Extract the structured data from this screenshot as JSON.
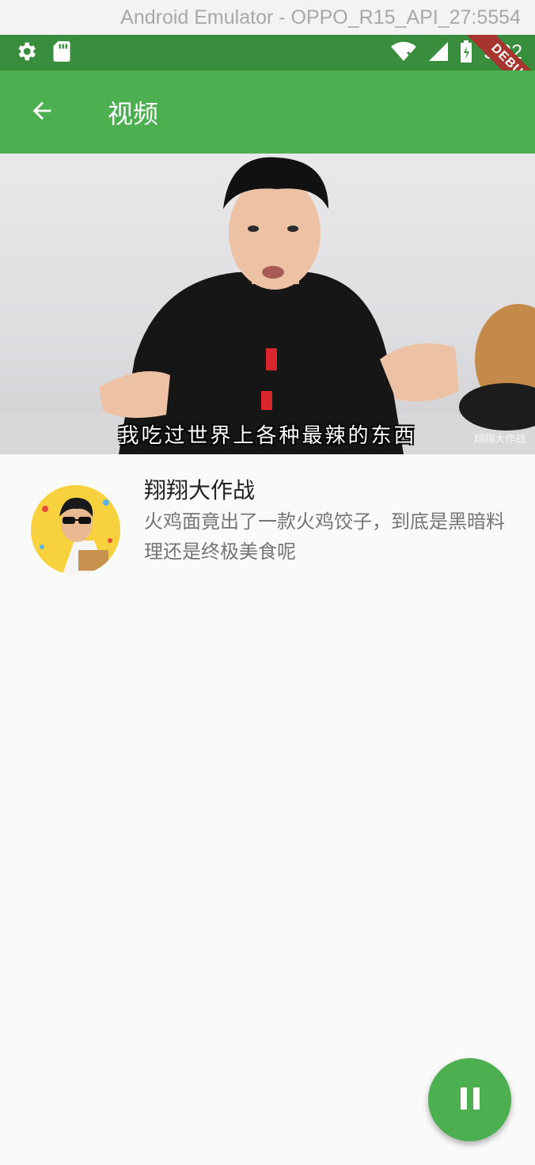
{
  "window": {
    "title": "Android Emulator - OPPO_R15_API_27:5554"
  },
  "status_bar": {
    "time": "3:32",
    "debug_label": "DEBUG"
  },
  "app_bar": {
    "title": "视频",
    "back_icon": "arrow-back-icon"
  },
  "video": {
    "subtitle": "我吃过世界上各种最辣的东西",
    "watermark": "翔翔大作战"
  },
  "info": {
    "author": "翔翔大作战",
    "description": "火鸡面竟出了一款火鸡饺子，到底是黑暗料理还是终极美食呢"
  },
  "fab": {
    "icon": "pause-icon"
  },
  "colors": {
    "primary": "#4caf50",
    "primary_dark": "#388e3c",
    "debug_ribbon": "#a7352d"
  }
}
